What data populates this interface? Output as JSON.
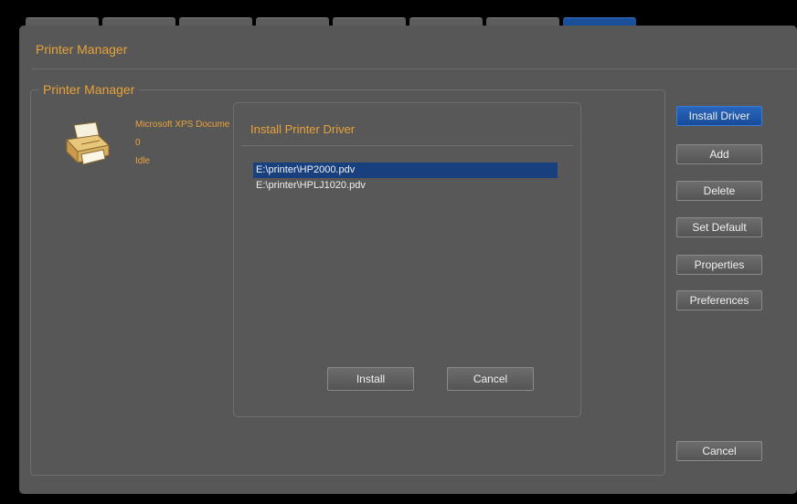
{
  "colors": {
    "accent_text": "#e8a23a",
    "window_bg": "#575757",
    "selection": "#18407f",
    "primary_button": "#1f5aad"
  },
  "tabs": [
    {
      "active": false
    },
    {
      "active": false
    },
    {
      "active": false
    },
    {
      "active": false
    },
    {
      "active": false
    },
    {
      "active": false
    },
    {
      "active": false
    },
    {
      "active": true
    }
  ],
  "window": {
    "title": "Printer Manager",
    "group_label": "Printer Manager"
  },
  "printer": {
    "icon": "printer-icon",
    "name": "Microsoft XPS Docume",
    "jobs": "0",
    "status": "Idle"
  },
  "sidebar": {
    "install_driver": "Install Driver",
    "add": "Add",
    "delete": "Delete",
    "set_default": "Set Default",
    "properties": "Properties",
    "preferences": "Preferences",
    "cancel": "Cancel"
  },
  "dialog": {
    "title": "Install Printer Driver",
    "drivers": [
      {
        "path": "E:\\printer\\HP2000.pdv",
        "selected": true
      },
      {
        "path": "E:\\printer\\HPLJ1020.pdv",
        "selected": false
      }
    ],
    "install_label": "Install",
    "cancel_label": "Cancel"
  }
}
